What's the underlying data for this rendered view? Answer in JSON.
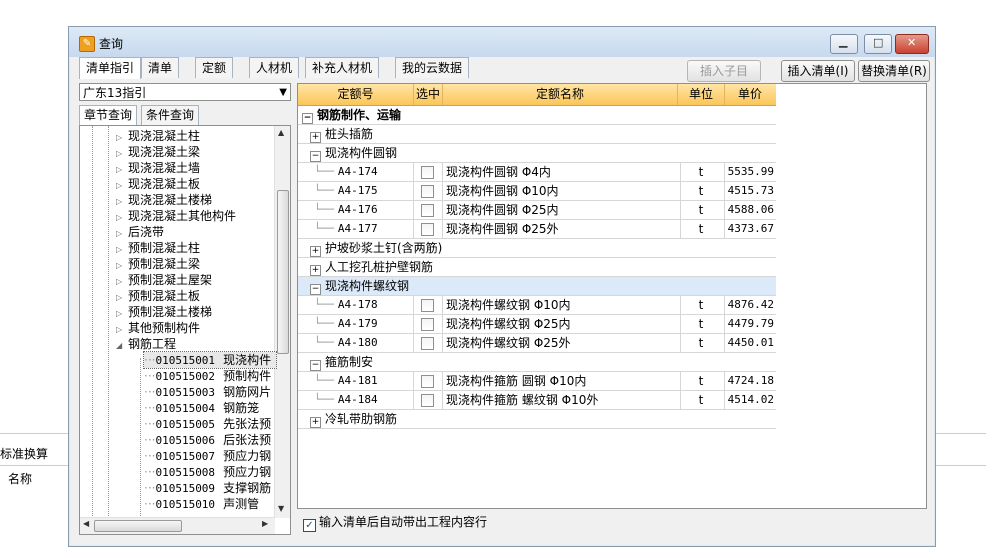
{
  "background": {
    "toolbar_label": "标准换算",
    "column_label": "名称"
  },
  "window": {
    "title": "查询",
    "icon": "query-app-icon"
  },
  "tabs": [
    "清单指引",
    "清单",
    "定额",
    "人材机",
    "补充人材机",
    "我的云数据"
  ],
  "buttons": {
    "insert_child": "插入子目",
    "insert_list": "插入清单(I)",
    "replace_list": "替换清单(R)"
  },
  "left": {
    "combo_value": "广东13指引",
    "subtabs": [
      "章节查询",
      "条件查询"
    ],
    "tree": [
      {
        "label": "现浇混凝土柱",
        "expanded": false
      },
      {
        "label": "现浇混凝土梁",
        "expanded": false
      },
      {
        "label": "现浇混凝土墙",
        "expanded": false
      },
      {
        "label": "现浇混凝土板",
        "expanded": false
      },
      {
        "label": "现浇混凝土楼梯",
        "expanded": false
      },
      {
        "label": "现浇混凝土其他构件",
        "expanded": false
      },
      {
        "label": "后浇带",
        "expanded": false
      },
      {
        "label": "预制混凝土柱",
        "expanded": false
      },
      {
        "label": "预制混凝土梁",
        "expanded": false
      },
      {
        "label": "预制混凝土屋架",
        "expanded": false
      },
      {
        "label": "预制混凝土板",
        "expanded": false
      },
      {
        "label": "预制混凝土楼梯",
        "expanded": false
      },
      {
        "label": "其他预制构件",
        "expanded": false
      },
      {
        "label": "钢筋工程",
        "expanded": true
      }
    ],
    "children": [
      {
        "code": "010515001",
        "name": "现浇构件"
      },
      {
        "code": "010515002",
        "name": "预制构件"
      },
      {
        "code": "010515003",
        "name": "钢筋网片"
      },
      {
        "code": "010515004",
        "name": "钢筋笼"
      },
      {
        "code": "010515005",
        "name": "先张法预"
      },
      {
        "code": "010515006",
        "name": "后张法预"
      },
      {
        "code": "010515007",
        "name": "预应力钢"
      },
      {
        "code": "010515008",
        "name": "预应力钢"
      },
      {
        "code": "010515009",
        "name": "支撑钢筋"
      },
      {
        "code": "010515010",
        "name": "声测管"
      }
    ]
  },
  "grid": {
    "headers": [
      "定额号",
      "选中",
      "定额名称",
      "单位",
      "单价"
    ],
    "root": "钢筋制作、运输",
    "groups": [
      {
        "label": "桩头插筋",
        "expanded": false,
        "rows": []
      },
      {
        "label": "现浇构件圆钢",
        "expanded": true,
        "rows": [
          {
            "code": "A4-174",
            "name": "现浇构件圆钢 Φ4内",
            "unit": "t",
            "price": "5535.99"
          },
          {
            "code": "A4-175",
            "name": "现浇构件圆钢 Φ10内",
            "unit": "t",
            "price": "4515.73"
          },
          {
            "code": "A4-176",
            "name": "现浇构件圆钢 Φ25内",
            "unit": "t",
            "price": "4588.06"
          },
          {
            "code": "A4-177",
            "name": "现浇构件圆钢 Φ25外",
            "unit": "t",
            "price": "4373.67"
          }
        ]
      },
      {
        "label": "护坡砂浆土钉(含两筋)",
        "expanded": false,
        "rows": []
      },
      {
        "label": "人工挖孔桩护壁钢筋",
        "expanded": false,
        "rows": []
      },
      {
        "label": "现浇构件螺纹钢",
        "expanded": true,
        "selected": true,
        "rows": [
          {
            "code": "A4-178",
            "name": "现浇构件螺纹钢 Φ10内",
            "unit": "t",
            "price": "4876.42"
          },
          {
            "code": "A4-179",
            "name": "现浇构件螺纹钢 Φ25内",
            "unit": "t",
            "price": "4479.79"
          },
          {
            "code": "A4-180",
            "name": "现浇构件螺纹钢 Φ25外",
            "unit": "t",
            "price": "4450.01"
          }
        ]
      },
      {
        "label": "箍筋制安",
        "expanded": true,
        "rows": [
          {
            "code": "A4-181",
            "name": "现浇构件箍筋 圆钢 Φ10内",
            "unit": "t",
            "price": "4724.18"
          },
          {
            "code": "A4-184",
            "name": "现浇构件箍筋 螺纹钢 Φ10外",
            "unit": "t",
            "price": "4514.02"
          }
        ]
      },
      {
        "label": "冷轧带肋钢筋",
        "expanded": false,
        "rows": []
      }
    ]
  },
  "footer": {
    "auto_check_label": "输入清单后自动带出工程内容行",
    "checked": true
  }
}
